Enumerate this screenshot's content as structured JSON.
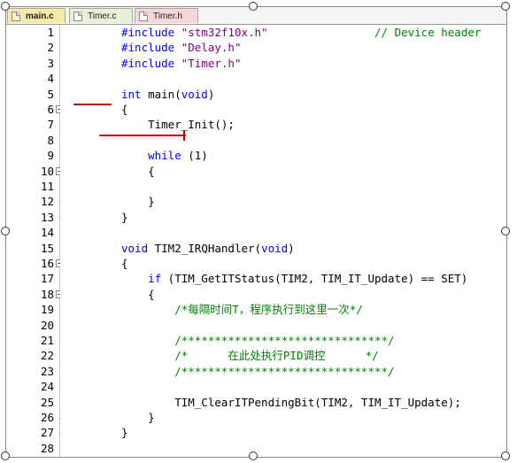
{
  "tabs": [
    {
      "label": "main.c",
      "active": true
    },
    {
      "label": "Timer.c",
      "active": false
    },
    {
      "label": "Timer.h",
      "active": false
    }
  ],
  "line_numbers": [
    "1",
    "2",
    "3",
    "4",
    "5",
    "6",
    "7",
    "8",
    "9",
    "10",
    "11",
    "12",
    "13",
    "14",
    "15",
    "16",
    "17",
    "18",
    "19",
    "20",
    "21",
    "22",
    "23",
    "24",
    "25",
    "26",
    "27",
    "28"
  ],
  "code": {
    "l1_kw": "#include",
    "l1_str": " \"stm32f10x.h\"",
    "l1_cm": "                // Device header",
    "l2_kw": "#include",
    "l2_str": " \"Delay.h\"",
    "l3_kw": "#include",
    "l3_str": " \"Timer.h\"",
    "l5_kw": "int",
    "l5_rest": " main(",
    "l5_kw2": "void",
    "l5_end": ")",
    "l6": "{",
    "l7": "    Timer_Init();",
    "l9_kw": "    while",
    "l9_rest": " (1)",
    "l10": "    {",
    "l12": "    }",
    "l13": "}",
    "l15_kw": "void",
    "l15_rest": " TIM2_IRQHandler(",
    "l15_kw2": "void",
    "l15_end": ")",
    "l16": "{",
    "l17_kw": "    if",
    "l17_rest": " (TIM_GetITStatus(TIM2, TIM_IT_Update) == SET)",
    "l18": "    {",
    "l19_cm": "        /*每隔时间T，程序执行到这里一次*/",
    "l21_cm": "        /*******************************/",
    "l22_cm": "        /*      在此处执行PID调控      */",
    "l23_cm": "        /*******************************/",
    "l25": "        TIM_ClearITPendingBit(TIM2, TIM_IT_Update);",
    "l26": "    }",
    "l27": "}"
  },
  "colors": {
    "keyword": "#0000ff",
    "string": "#800080",
    "comment": "#008000",
    "annotation": "#c00000"
  }
}
